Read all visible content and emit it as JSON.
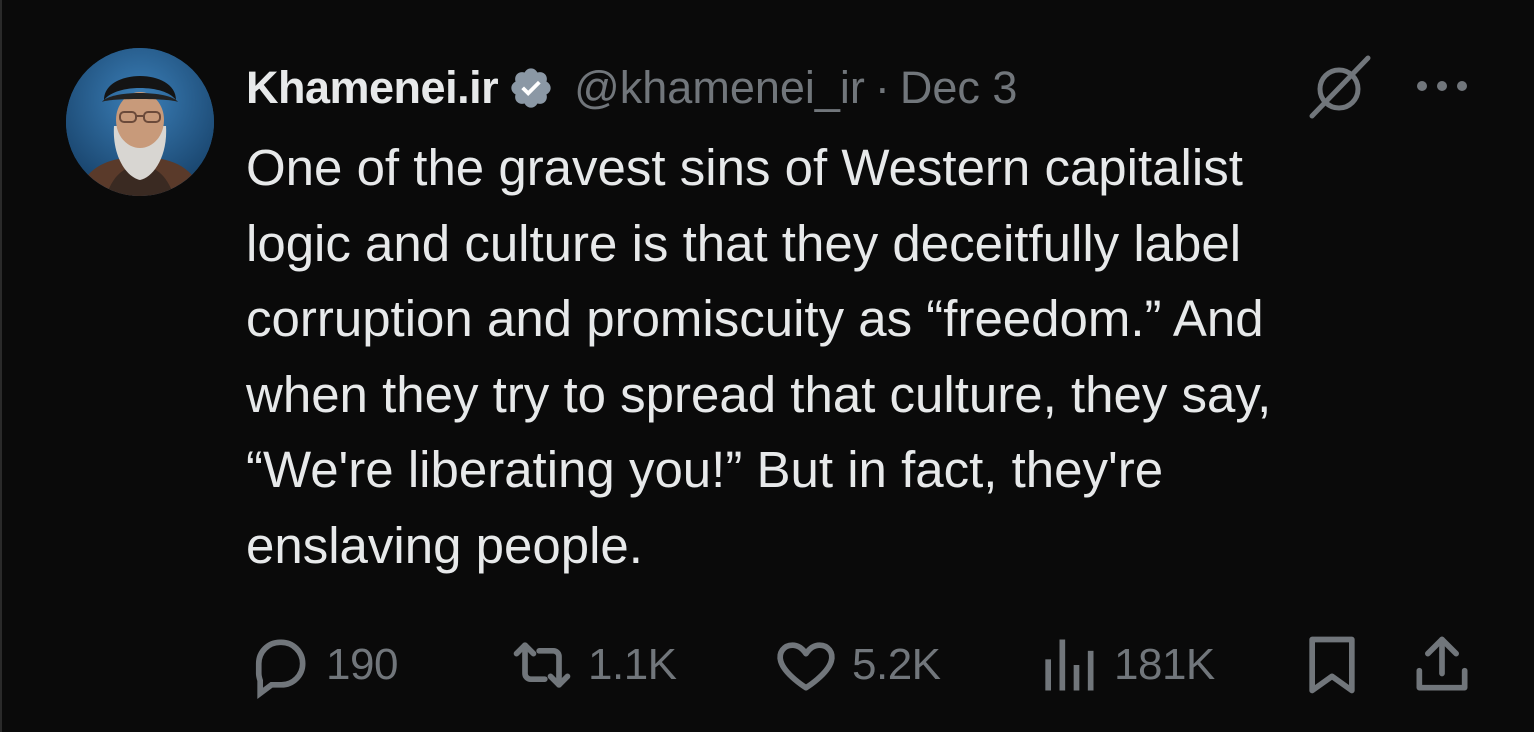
{
  "author": {
    "display_name": "Khamenei.ir",
    "handle": "@khamenei_ir",
    "separator": "·",
    "date": "Dec 3",
    "verified": true,
    "verified_color": "#8b98a5"
  },
  "tweet": {
    "lines": [
      "One of the gravest sins of Western capitalist",
      "logic and culture is that they deceitfully label",
      "corruption and promiscuity as “freedom.” And",
      "when they try to spread that culture, they say,",
      "“We're liberating you!” But in fact, they're",
      "enslaving people."
    ]
  },
  "actions": {
    "replies": "190",
    "reposts": "1.1K",
    "likes": "5.2K",
    "views": "181K"
  },
  "icons": {
    "grok": "grok-icon",
    "more": "more-icon",
    "reply": "reply-icon",
    "repost": "repost-icon",
    "like": "heart-icon",
    "views": "views-icon",
    "bookmark": "bookmark-icon",
    "share": "share-icon"
  },
  "colors": {
    "background": "#0a0a0a",
    "text": "#e7e9ea",
    "secondary": "#71767b"
  }
}
